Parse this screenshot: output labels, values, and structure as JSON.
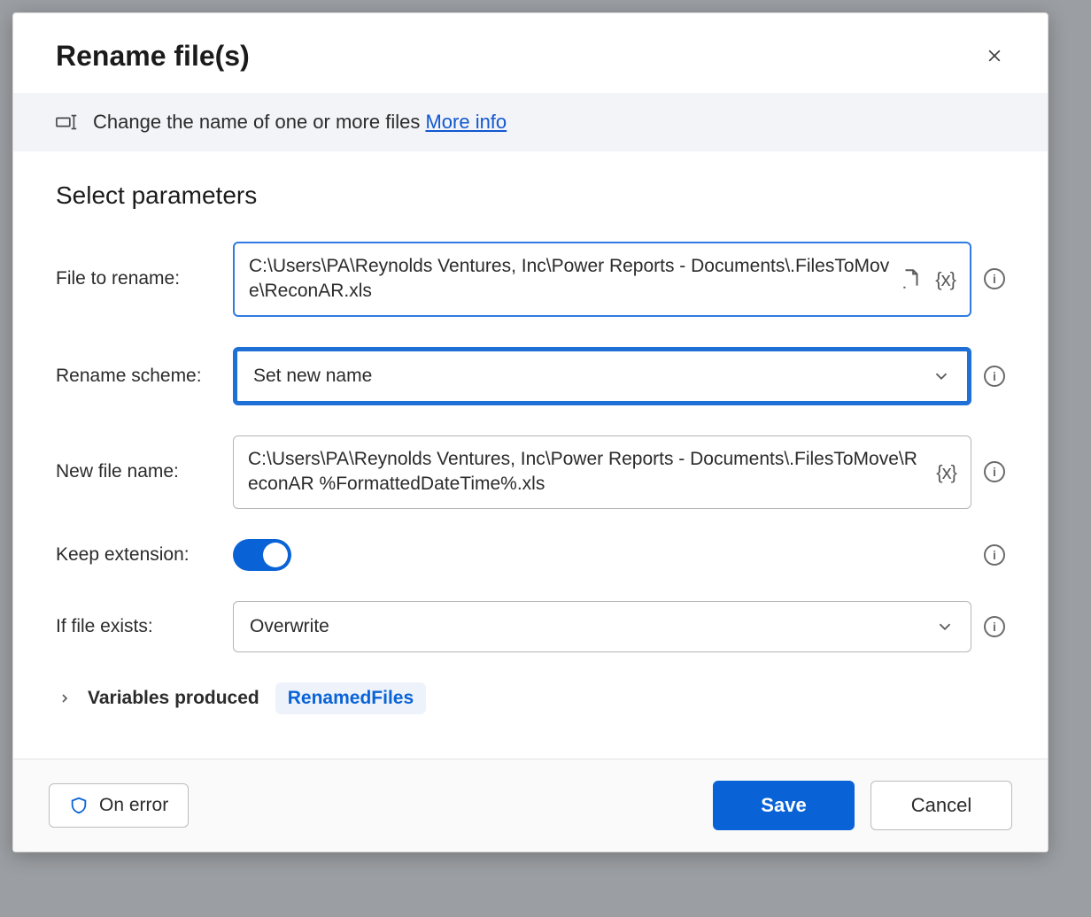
{
  "dialog": {
    "title": "Rename file(s)",
    "description": "Change the name of one or more files",
    "more_info_label": "More info",
    "section_title": "Select parameters"
  },
  "fields": {
    "file_to_rename": {
      "label": "File to rename:",
      "value": "C:\\Users\\PA\\Reynolds Ventures, Inc\\Power Reports - Documents\\.FilesToMove\\ReconAR.xls"
    },
    "rename_scheme": {
      "label": "Rename scheme:",
      "value": "Set new name"
    },
    "new_file_name": {
      "label": "New file name:",
      "value": "C:\\Users\\PA\\Reynolds Ventures, Inc\\Power Reports - Documents\\.FilesToMove\\ReconAR %FormattedDateTime%.xls"
    },
    "keep_extension": {
      "label": "Keep extension:",
      "on": true
    },
    "if_file_exists": {
      "label": "If file exists:",
      "value": "Overwrite"
    }
  },
  "variables": {
    "label": "Variables produced",
    "chip": "RenamedFiles"
  },
  "footer": {
    "on_error": "On error",
    "save": "Save",
    "cancel": "Cancel"
  },
  "icons": {
    "variable_token": "{x}"
  }
}
